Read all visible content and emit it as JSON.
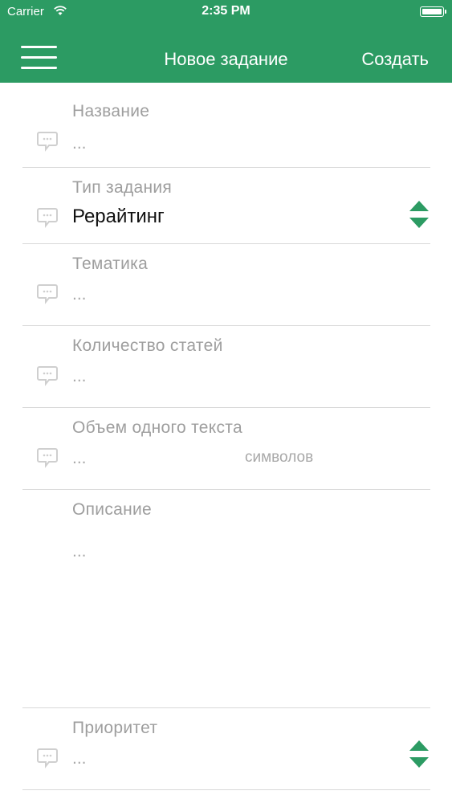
{
  "status_bar": {
    "carrier": "Carrier",
    "time": "2:35 PM"
  },
  "header": {
    "title": "Новое задание",
    "create_label": "Создать"
  },
  "colors": {
    "accent": "#2c9b63",
    "label": "#9e9e9e",
    "divider": "#d9d9d9"
  },
  "form": {
    "name": {
      "label": "Название",
      "value": "..."
    },
    "task_type": {
      "label": "Тип задания",
      "value": "Рерайтинг"
    },
    "topic": {
      "label": "Тематика",
      "value": "..."
    },
    "articles_count": {
      "label": "Количество статей",
      "value": "..."
    },
    "text_volume": {
      "label": "Объем одного текста",
      "value": "...",
      "units": "символов"
    },
    "description": {
      "label": "Описание",
      "value": "..."
    },
    "priority": {
      "label": "Приоритет",
      "value": "..."
    }
  },
  "icons": {
    "menu": "hamburger-menu-icon",
    "field": "chat-bubble-icon",
    "stepper": "up-down-arrows-icon"
  }
}
